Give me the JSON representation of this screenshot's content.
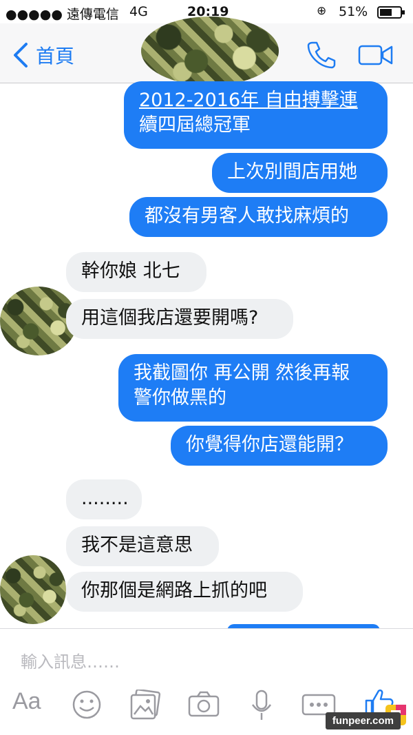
{
  "status_bar": {
    "signal": "●●●●● 遠傳電信",
    "network": "4G",
    "time": "20:19",
    "battery": "51%"
  },
  "header": {
    "back_label": "首頁",
    "icons": [
      "chevron-left-icon",
      "phone-icon",
      "video-camera-icon"
    ],
    "accent_color": "#1e7cf2"
  },
  "messages": [
    {
      "side": "out",
      "text_line1": "2012-2016年 自由搏擊連",
      "text_line2": "續四屆總冠軍"
    },
    {
      "side": "out",
      "text": "上次別間店用她"
    },
    {
      "side": "out",
      "text": "都沒有男客人敢找麻煩的"
    },
    {
      "side": "in",
      "text": "幹你娘 北七"
    },
    {
      "side": "in",
      "text": "用這個我店還要開嗎?"
    },
    {
      "side": "out",
      "text_line1": "我截圖你 再公開 然後再報",
      "text_line2": "警你做黑的"
    },
    {
      "side": "out",
      "text": "你覺得你店還能開？"
    },
    {
      "side": "in",
      "text": "........"
    },
    {
      "side": "in",
      "text": "我不是這意思"
    },
    {
      "side": "in",
      "text": "你那個是網路上抓的吧"
    }
  ],
  "composer": {
    "placeholder": "輸入訊息……",
    "text_format_label": "Aa",
    "tools": [
      "text-format-icon",
      "emoji-icon",
      "gallery-icon",
      "camera-icon",
      "microphone-icon",
      "more-icon",
      "like-icon"
    ]
  },
  "watermark": "funpeer.com",
  "colors": {
    "outgoing_bubble": "#1e7df5",
    "incoming_bubble": "#eef0f2"
  }
}
